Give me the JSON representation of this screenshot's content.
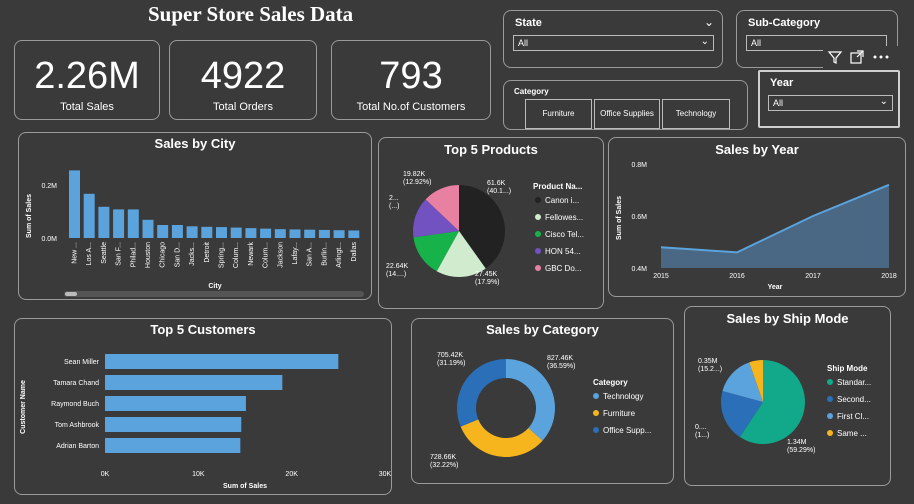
{
  "page_title": "Super Store Sales Data",
  "kpis": [
    {
      "value": "2.26M",
      "label": "Total Sales"
    },
    {
      "value": "4922",
      "label": "Total Orders"
    },
    {
      "value": "793",
      "label": "Total No.of Customers"
    }
  ],
  "slicers": {
    "state": {
      "label": "State",
      "value": "All"
    },
    "sub_category": {
      "label": "Sub-Category",
      "value": "All"
    },
    "year": {
      "label": "Year",
      "value": "All"
    },
    "category": {
      "label": "Category",
      "options": [
        "Furniture",
        "Office Supplies",
        "Technology"
      ]
    }
  },
  "icons": [
    "filter-icon",
    "focus-mode-icon",
    "more-options-icon",
    "chevron-down-icon"
  ],
  "colors": {
    "bar": "#5ba3dc",
    "background": "#3a3a3a",
    "border": "#9a9a9a"
  },
  "sales_by_city": {
    "title": "Sales by City",
    "ylabel": "Sum of Sales",
    "xlabel": "City",
    "yticks": [
      "0.2M",
      "0.0M"
    ],
    "categories": [
      "New ...",
      "Los A...",
      "Seattle",
      "San F...",
      "Philad...",
      "Houston",
      "Chicago",
      "San D...",
      "Jacks...",
      "Detroit",
      "Spring...",
      "Colum...",
      "Newark",
      "Colum...",
      "Jackson",
      "Lafay...",
      "San A...",
      "Burlin...",
      "Arlingt...",
      "Dallas"
    ],
    "values": [
      0.26,
      0.17,
      0.12,
      0.11,
      0.11,
      0.07,
      0.05,
      0.05,
      0.045,
      0.043,
      0.042,
      0.04,
      0.038,
      0.036,
      0.034,
      0.033,
      0.032,
      0.031,
      0.03,
      0.029
    ]
  },
  "top5_products": {
    "title": "Top 5 Products",
    "legend_title": "Product Na...",
    "legend": [
      {
        "name": "Canon i...",
        "color": "#222222"
      },
      {
        "name": "Fellowes...",
        "color": "#d1ebcf"
      },
      {
        "name": "Cisco Tel...",
        "color": "#17b24a"
      },
      {
        "name": "HON 54...",
        "color": "#7251c1"
      },
      {
        "name": "GBC Do...",
        "color": "#e880a2"
      }
    ],
    "labels": [
      "61.6K\n(40.1...)",
      "27.45K\n(17.9%)",
      "22.64K\n(14....)",
      "2...\n(...)",
      "19.82K\n(12.92%)"
    ],
    "values": [
      61.6,
      27.45,
      22.64,
      21.93,
      19.82
    ]
  },
  "sales_by_year": {
    "title": "Sales by Year",
    "ylabel": "Sum of Sales",
    "xlabel": "Year",
    "x": [
      "2015",
      "2016",
      "2017",
      "2018"
    ],
    "y": [
      0.48,
      0.46,
      0.6,
      0.72
    ],
    "yticks": [
      "0.8M",
      "0.6M",
      "0.4M"
    ],
    "ylim": [
      0.4,
      0.8
    ]
  },
  "top5_customers": {
    "title": "Top 5 Customers",
    "ylabel": "Customer Name",
    "xlabel": "Sum of Sales",
    "categories": [
      "Sean Miller",
      "Tamara Chand",
      "Raymond Buch",
      "Tom Ashbrook",
      "Adrian Barton"
    ],
    "values": [
      25000,
      19000,
      15100,
      14600,
      14500
    ],
    "xticks": [
      "0K",
      "10K",
      "20K",
      "30K"
    ],
    "xlim": [
      0,
      30000
    ]
  },
  "sales_by_category": {
    "title": "Sales by Category",
    "legend_title": "Category",
    "legend": [
      {
        "name": "Technology",
        "color": "#5ba3dc"
      },
      {
        "name": "Furniture",
        "color": "#f6b51c"
      },
      {
        "name": "Office Supp...",
        "color": "#2b6fb8"
      }
    ],
    "labels": [
      "827.46K\n(36.59%)",
      "728.66K\n(32.22%)",
      "705.42K\n(31.19%)"
    ],
    "values": [
      827.46,
      728.66,
      705.42
    ]
  },
  "sales_by_ship_mode": {
    "title": "Sales by Ship Mode",
    "legend_title": "Ship Mode",
    "legend": [
      {
        "name": "Standar...",
        "color": "#12a88a"
      },
      {
        "name": "Second...",
        "color": "#2b6fb8"
      },
      {
        "name": "First Cl...",
        "color": "#5ba3dc"
      },
      {
        "name": "Same ...",
        "color": "#f6b51c"
      }
    ],
    "labels": [
      "1.34M\n(59.29%)",
      "0....\n(1...)",
      "0.35M\n(15.2...)"
    ],
    "values": [
      1.34,
      0.45,
      0.35,
      0.12
    ]
  }
}
